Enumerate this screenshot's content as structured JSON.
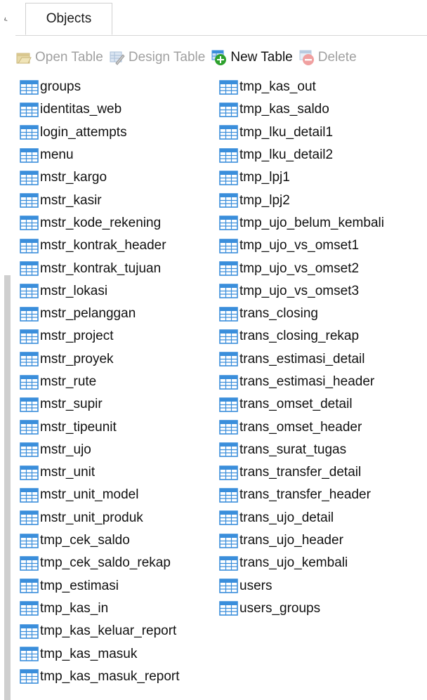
{
  "tab": {
    "label": "Objects"
  },
  "toolbar": {
    "open_table": "Open Table",
    "design_table": "Design Table",
    "new_table": "New Table",
    "delete": "Delete"
  },
  "colors": {
    "table_icon": "#3a8edb",
    "new_table_icon": "#2ea12e",
    "delete_icon": "#d94040"
  },
  "column1": [
    "groups",
    "identitas_web",
    "login_attempts",
    "menu",
    "mstr_kargo",
    "mstr_kasir",
    "mstr_kode_rekening",
    "mstr_kontrak_header",
    "mstr_kontrak_tujuan",
    "mstr_lokasi",
    "mstr_pelanggan",
    "mstr_project",
    "mstr_proyek",
    "mstr_rute",
    "mstr_supir",
    "mstr_tipeunit",
    "mstr_ujo",
    "mstr_unit",
    "mstr_unit_model",
    "mstr_unit_produk",
    "tmp_cek_saldo",
    "tmp_cek_saldo_rekap",
    "tmp_estimasi",
    "tmp_kas_in",
    "tmp_kas_keluar_report",
    "tmp_kas_masuk",
    "tmp_kas_masuk_report"
  ],
  "column2": [
    "tmp_kas_out",
    "tmp_kas_saldo",
    "tmp_lku_detail1",
    "tmp_lku_detail2",
    "tmp_lpj1",
    "tmp_lpj2",
    "tmp_ujo_belum_kembali",
    "tmp_ujo_vs_omset1",
    "tmp_ujo_vs_omset2",
    "tmp_ujo_vs_omset3",
    "trans_closing",
    "trans_closing_rekap",
    "trans_estimasi_detail",
    "trans_estimasi_header",
    "trans_omset_detail",
    "trans_omset_header",
    "trans_surat_tugas",
    "trans_transfer_detail",
    "trans_transfer_header",
    "trans_ujo_detail",
    "trans_ujo_header",
    "trans_ujo_kembali",
    "users",
    "users_groups"
  ]
}
